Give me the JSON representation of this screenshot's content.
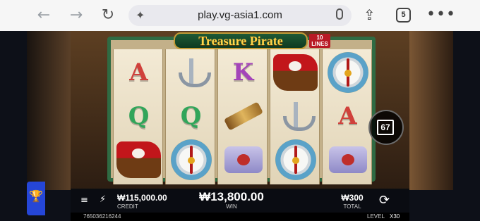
{
  "browser": {
    "url": "play.vg-asia1.com",
    "tab_count": "5"
  },
  "game": {
    "title": "Treasure Pirate",
    "lines_label": "10\nLINES",
    "side_counter": "67",
    "credit_value": "₩115,000.00",
    "credit_label": "CREDIT",
    "win_value": "₩13,800.00",
    "win_label": "WIN",
    "total_value": "₩300",
    "total_label": "TOTAL",
    "round_id": "765036216244",
    "level_label": "LEVEL",
    "level_value": "X30"
  },
  "symbols": [
    [
      "A",
      "Q",
      "ship"
    ],
    [
      "anchor",
      "Q",
      "compass"
    ],
    [
      "K",
      "telescope",
      "scroll"
    ],
    [
      "ship",
      "anchor",
      "compass"
    ],
    [
      "compass",
      "A",
      "scroll"
    ]
  ],
  "colors": {
    "accent": "#2f6b43",
    "win_text": "#ffffff",
    "title_gold": "#ffd54a",
    "trophy_button": "#2546d7"
  }
}
